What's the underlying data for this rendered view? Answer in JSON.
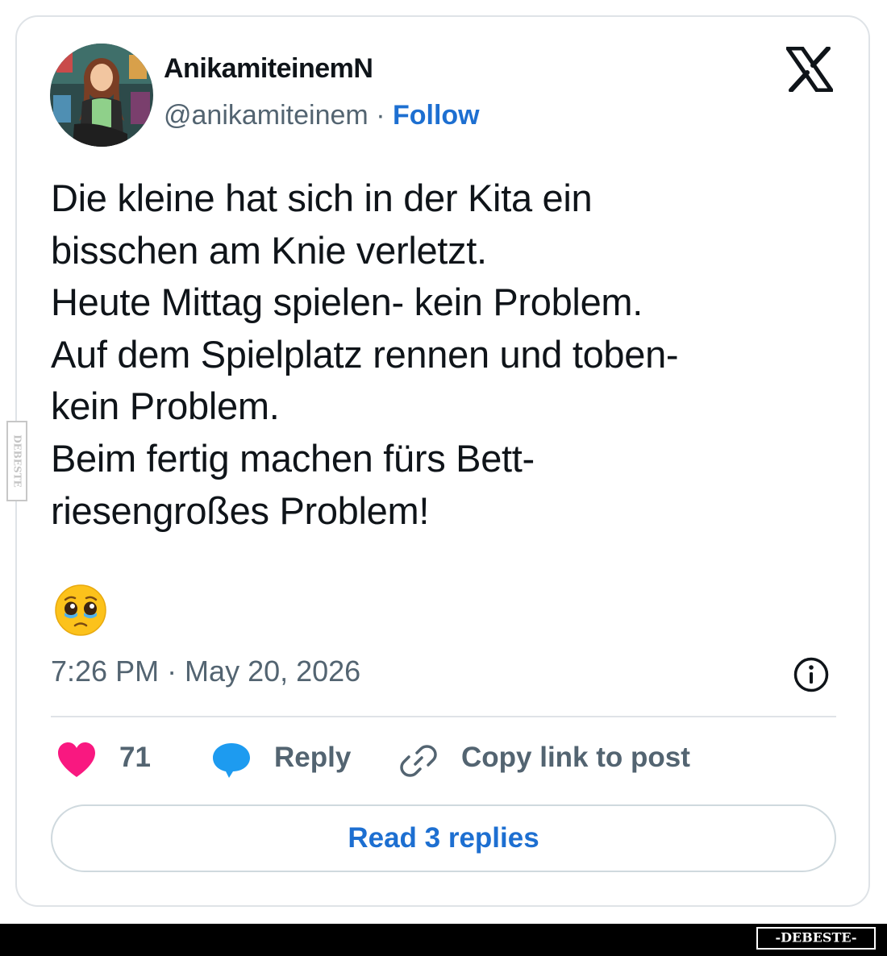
{
  "author": {
    "display_name": "AnikamiteinemN",
    "handle": "@anikamiteinem",
    "separator": "·",
    "follow_label": "Follow"
  },
  "tweet": {
    "lines": [
      "Die kleine hat sich in der Kita ein",
      "bisschen am Knie verletzt.",
      "Heute Mittag spielen- kein Problem.",
      "Auf dem Spielplatz rennen und toben-",
      "kein Problem.",
      "Beim fertig machen fürs Bett-",
      "riesengroßes Problem!"
    ],
    "emoji": "pleading-face-with-tears",
    "timestamp": "7:26 PM · May 20, 2026"
  },
  "actions": {
    "like_count": "71",
    "reply_label": "Reply",
    "copy_link_label": "Copy link to post"
  },
  "read_replies_label": "Read 3 replies",
  "watermark": "-DEBESTE-",
  "colors": {
    "text": "#0f1419",
    "secondary": "#536471",
    "link": "#1d6fd1",
    "heart": "#f91880",
    "reply_bubble": "#1d9bf0",
    "border": "#dfe3e7"
  }
}
